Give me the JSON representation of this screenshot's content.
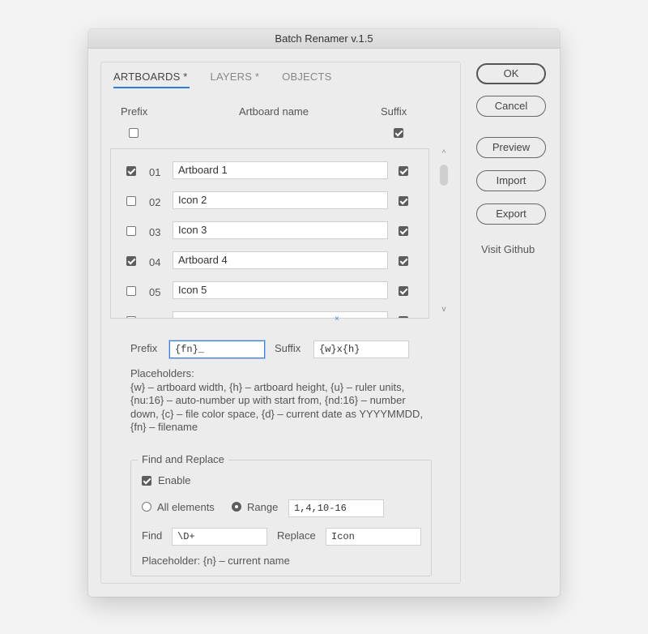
{
  "window": {
    "title": "Batch Renamer v.1.5"
  },
  "tabs": [
    {
      "label": "ARTBOARDS *",
      "active": true
    },
    {
      "label": "LAYERS *",
      "active": false
    },
    {
      "label": "OBJECTS",
      "active": false
    }
  ],
  "columns": {
    "prefix": "Prefix",
    "name": "Artboard name",
    "suffix": "Suffix"
  },
  "header_checks": {
    "prefix_all": false,
    "suffix_all": true
  },
  "rows": [
    {
      "prefix": true,
      "num": "01",
      "name": "Artboard 1",
      "suffix": true
    },
    {
      "prefix": false,
      "num": "02",
      "name": "Icon 2",
      "suffix": true
    },
    {
      "prefix": false,
      "num": "03",
      "name": "Icon 3",
      "suffix": true
    },
    {
      "prefix": true,
      "num": "04",
      "name": "Artboard 4",
      "suffix": true
    },
    {
      "prefix": false,
      "num": "05",
      "name": "Icon 5",
      "suffix": true
    }
  ],
  "scroll": {
    "up": "^",
    "down": "v",
    "clear": "×"
  },
  "options": {
    "prefix_label": "Prefix",
    "prefix_value": "{fn}_",
    "suffix_label": "Suffix",
    "suffix_value": "{w}x{h}"
  },
  "placeholders": {
    "title": "Placeholders:",
    "text": "{w} – artboard width, {h} – artboard height, {u} – ruler units, {nu:16} – auto-number up with start from, {nd:16} – number down, {c} – file color space, {d} – current date as YYYYMMDD, {fn} – filename"
  },
  "find_replace": {
    "legend": "Find and Replace",
    "enable_label": "Enable",
    "enabled": true,
    "all_label": "All elements",
    "range_label": "Range",
    "range_selected": true,
    "range_value": "1,4,10-16",
    "find_label": "Find",
    "find_value": "\\D+",
    "replace_label": "Replace",
    "replace_value": "Icon",
    "hint": "Placeholder: {n} – current name"
  },
  "buttons": {
    "ok": "OK",
    "cancel": "Cancel",
    "preview": "Preview",
    "import": "Import",
    "export": "Export",
    "github": "Visit Github"
  }
}
